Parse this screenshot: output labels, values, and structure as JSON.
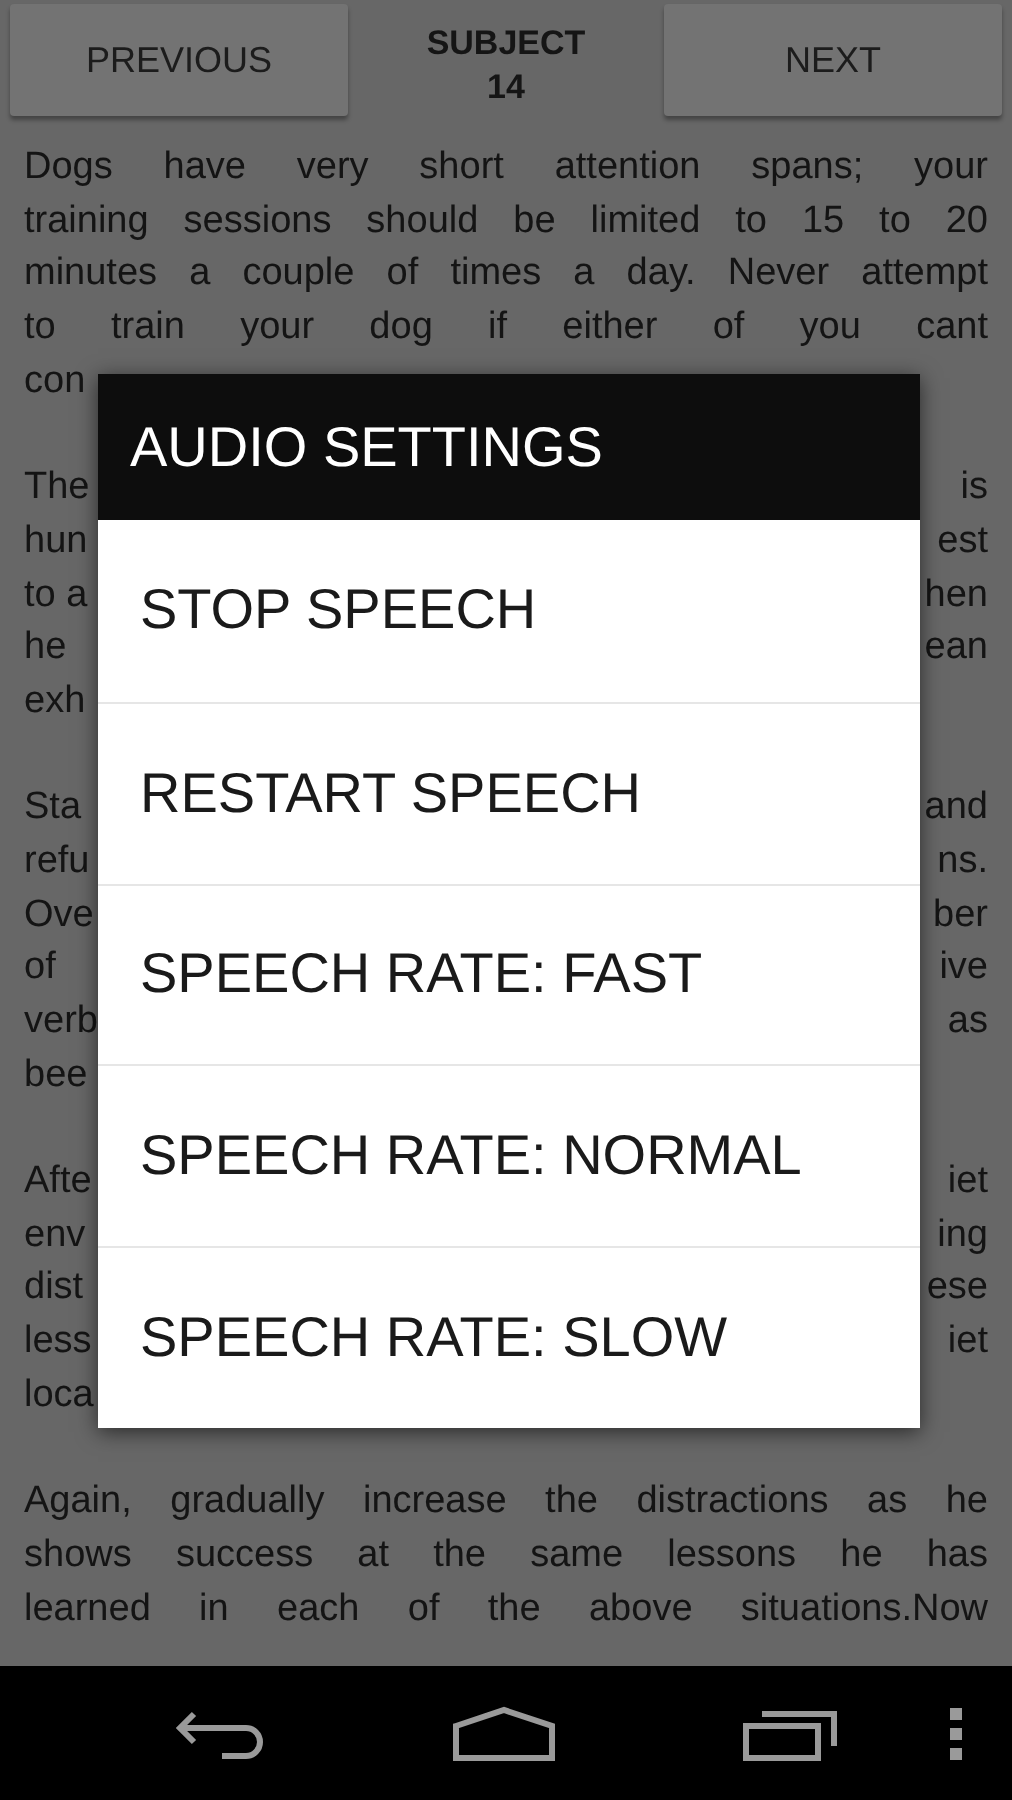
{
  "header": {
    "previous": "PREVIOUS",
    "title": "SUBJECT",
    "number": "14",
    "next": "NEXT"
  },
  "paragraphs": [
    {
      "lines": [
        {
          "kind": "full",
          "text": "Dogs have very short attention spans; your"
        },
        {
          "kind": "full",
          "text": "training sessions should be limited to 15 to 20"
        },
        {
          "kind": "full",
          "text": "minutes a couple of times a day. Never attempt"
        },
        {
          "kind": "full",
          "text": "to train your dog if either of you cant"
        },
        {
          "kind": "split",
          "left": "con"
        }
      ]
    },
    {
      "lines": [
        {
          "kind": "split",
          "left": "The",
          "right": "is"
        },
        {
          "kind": "split",
          "left": "hun",
          "right": "est"
        },
        {
          "kind": "split",
          "left": "to a",
          "right": "hen"
        },
        {
          "kind": "split",
          "left": "he",
          "right": "ean"
        },
        {
          "kind": "split",
          "left": "exh"
        }
      ]
    },
    {
      "lines": [
        {
          "kind": "split",
          "left": "Sta",
          "right": "and"
        },
        {
          "kind": "split",
          "left": "refu",
          "right": "ns."
        },
        {
          "kind": "split",
          "left": "Ove",
          "right": "ber"
        },
        {
          "kind": "split",
          "left": "of",
          "right": "ive"
        },
        {
          "kind": "split",
          "left": "verb",
          "right": "as"
        },
        {
          "kind": "split",
          "left": "bee"
        }
      ]
    },
    {
      "lines": [
        {
          "kind": "split",
          "left": "Afte",
          "right": "iet"
        },
        {
          "kind": "split",
          "left": "env",
          "right": "ing"
        },
        {
          "kind": "split",
          "left": "dist",
          "right": "ese"
        },
        {
          "kind": "split",
          "left": "less",
          "right": "iet"
        },
        {
          "kind": "split",
          "left": "loca"
        }
      ]
    },
    {
      "lines": [
        {
          "kind": "full",
          "text": "Again, gradually increase the distractions as he"
        },
        {
          "kind": "full",
          "text": "shows success at the same lessons he has"
        },
        {
          "kind": "full",
          "text": "learned in each of the above situations.Now"
        }
      ]
    }
  ],
  "dialog": {
    "title": "AUDIO SETTINGS",
    "items": [
      "STOP SPEECH",
      "RESTART SPEECH",
      "SPEECH RATE: FAST",
      "SPEECH RATE: NORMAL",
      "SPEECH RATE: SLOW"
    ]
  }
}
